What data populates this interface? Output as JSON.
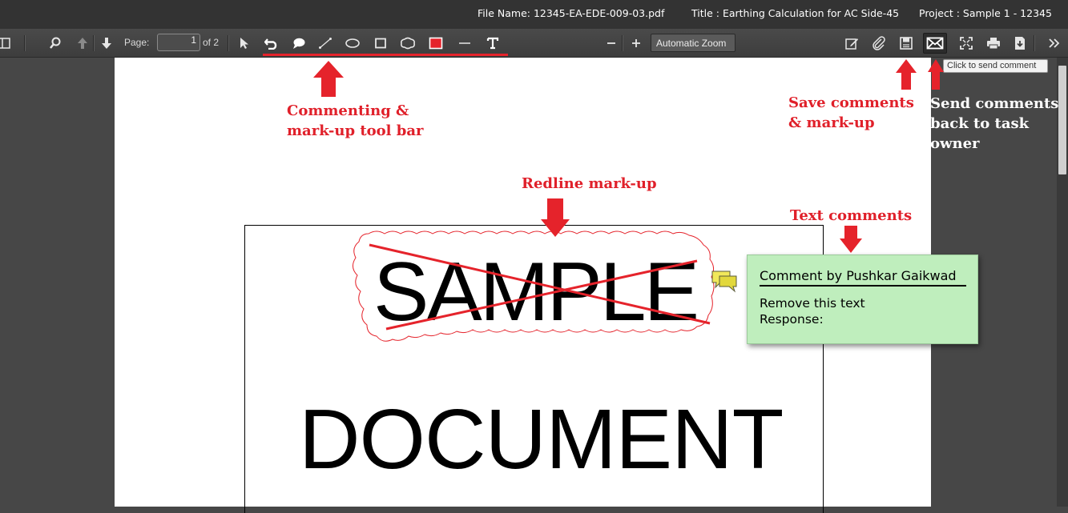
{
  "header": {
    "file_name": "File Name: 12345-EA-EDE-009-03.pdf",
    "title": "Title : Earthing Calculation for AC Side-45",
    "project": "Project : Sample 1 - 12345"
  },
  "toolbar": {
    "page_label": "Page:",
    "page_value": "1",
    "page_count": "of 2",
    "zoom_value": "Automatic Zoom",
    "tools": [
      "select-icon",
      "undo-icon",
      "comment-icon",
      "line-icon",
      "ellipse-icon",
      "rectangle-icon",
      "cloud-icon",
      "color-swatch-icon",
      "stroke-width-icon",
      "text-icon"
    ],
    "right_icons": [
      "edit-icon",
      "attach-icon",
      "save-icon",
      "send-comment-icon",
      "fullscreen-icon",
      "print-icon",
      "download-icon",
      "more-icon"
    ],
    "accent_red": "#e5232b"
  },
  "tooltip": {
    "send": "Click to send comment"
  },
  "annotations": {
    "toolbar_note_line1": "Commenting &",
    "toolbar_note_line2": "mark-up tool bar",
    "redline_note": "Redline mark-up",
    "save_note_line1": "Save comments",
    "save_note_line2": "& mark-up",
    "send_note_line1": "Send comments",
    "send_note_line2": "back to task",
    "send_note_line3": "owner",
    "text_comment_note": "Text comments"
  },
  "document": {
    "word1": "SAMPLE",
    "word2": "DOCUMENT"
  },
  "comment": {
    "title": "Comment by Pushkar Gaikwad",
    "line1": "Remove this text",
    "line2": "Response:"
  }
}
